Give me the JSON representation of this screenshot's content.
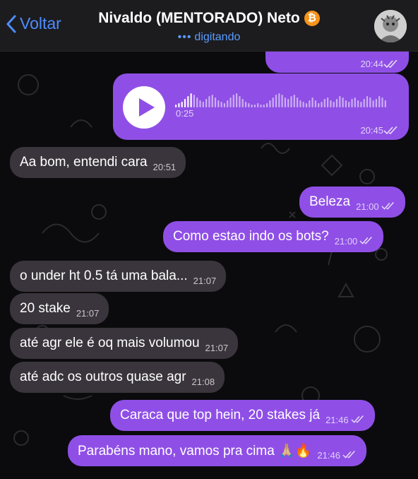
{
  "header": {
    "back_label": "Voltar",
    "title": "Nivaldo (MENTORADO) Neto",
    "badge_symbol": "₿",
    "status": "digitando"
  },
  "messages": {
    "prev_time": "20:44",
    "voice": {
      "duration": "0:25",
      "time": "20:45"
    },
    "m1": {
      "text": "Aa bom, entendi cara",
      "time": "20:51"
    },
    "m2": {
      "text": "Beleza",
      "time": "21:00"
    },
    "m3": {
      "text": "Como estao indo os bots?",
      "time": "21:00"
    },
    "m4": {
      "text": "o under ht 0.5 tá uma bala...",
      "time": "21:07"
    },
    "m5": {
      "text": "20 stake",
      "time": "21:07"
    },
    "m6": {
      "text": "até agr ele é oq mais volumou",
      "time": "21:07"
    },
    "m7": {
      "text": "até adc os outros quase agr",
      "time": "21:08"
    },
    "m8": {
      "text": "Caraca que top hein, 20 stakes já",
      "time": "21:46"
    },
    "m9": {
      "text": "Parabéns mano, vamos pra cima 🙏🏼🔥",
      "time": "21:46"
    }
  },
  "colors": {
    "incoming": "#3a353c",
    "outgoing": "#8f4fe6",
    "accent": "#4e8cff"
  }
}
